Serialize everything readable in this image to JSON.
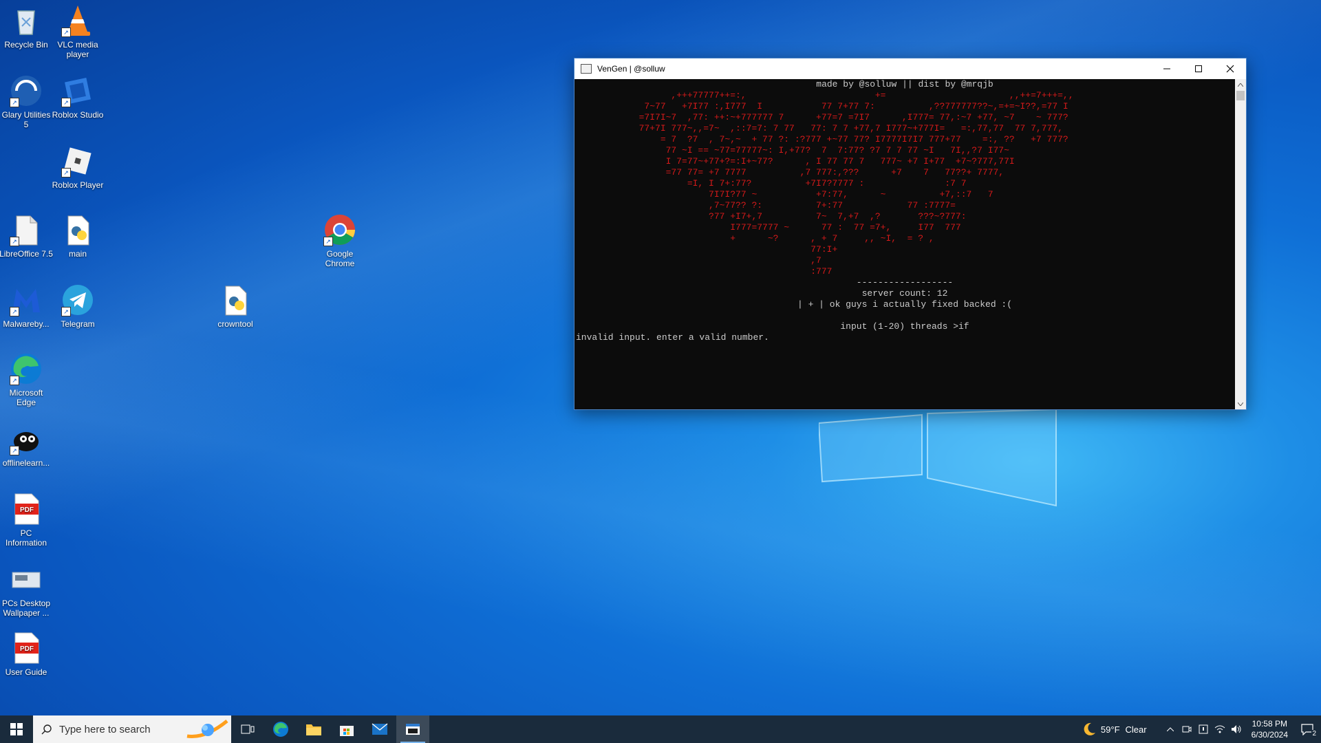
{
  "desktop": {
    "icons": [
      {
        "label": "Recycle Bin",
        "icon": "recycle-bin-icon"
      },
      {
        "label": "VLC media player",
        "icon": "vlc-icon"
      },
      {
        "label": "Glary Utilities 5",
        "icon": "glary-utilities-icon"
      },
      {
        "label": "Roblox Studio",
        "icon": "roblox-studio-icon"
      },
      {
        "label": "Roblox Player",
        "icon": "roblox-player-icon"
      },
      {
        "label": "LibreOffice 7.5",
        "icon": "libreoffice-icon"
      },
      {
        "label": "main",
        "icon": "python-file-icon"
      },
      {
        "label": "Google Chrome",
        "icon": "chrome-icon"
      },
      {
        "label": "Malwareby...",
        "icon": "malwarebytes-icon"
      },
      {
        "label": "Telegram",
        "icon": "telegram-icon"
      },
      {
        "label": "crowntool",
        "icon": "python-file-icon"
      },
      {
        "label": "Microsoft Edge",
        "icon": "edge-icon"
      },
      {
        "label": "offlinelearn...",
        "icon": "offlinelearn-icon"
      },
      {
        "label": "PC Information",
        "icon": "pdf-icon"
      },
      {
        "label": "PCs Desktop Wallpaper ...",
        "icon": "wallpaper-icon"
      },
      {
        "label": "User Guide",
        "icon": "pdf-icon"
      }
    ]
  },
  "window": {
    "title": "VenGen | @solluw",
    "console": {
      "header": "made by @solluw || dist by @mrqjb",
      "art": [
        "                  ,+++77777++=:,                        +=                       ,,++=7+++=,,",
        "             7~77   +7I77 :,I777  I           77 7+77 7:          ,??777777??~,=+=~I??,=77 I",
        "            =7I7I~7  ,77: ++:~+777777 7      +77=7 =7I7      ,I777= 77,:~7 +77, ~7    ~ 777?",
        "            77+7I 777~,,=7~  ,::7=7: 7 77   77: 7 7 +77,7 I777~+777I=   =:,77,77  77 7,777,",
        "                = 7  ?7  , 7~,~  + 77 ?: :?777 +~77 77? I7777I7I7 777+77    =:, ??   +7 777?",
        "                 77 ~I == ~77=77777~: I,+77?  7  7:77? ?7 7 7 77 ~I   7I,,?7 I77~",
        "                 I 7=77~+77+?=:I+~77?      , I 77 77 7   777~ +7 I+77  +7~?777,77I",
        "                 =77 77= +7 7777          ,7 777:,???      +7    7   77??+ 7777,",
        "                     =I, I 7+:77?          +7I7?7777 :               :7 7",
        "                         7I7I?77 ~           +7:77,      ~          +7,::7   7",
        "                         ,7~77?? ?:          7+:77            77 :7777=",
        "                         ?77 +I7+,7          7~  7,+7  ,?       ???~?777:",
        "                             I777=7777 ~      77 :  77 =7+,     I77  777",
        "                             +      ~?      , + 7     ,, ~I,  = ? ,",
        "                                            77:I+",
        "                                            ,7",
        "                                            :777"
      ],
      "divider": "------------------",
      "server_count": "server count: 12",
      "message": "| + | ok guys i actually fixed backed :(",
      "prompt": "input (1-20) threads >if",
      "error": "invalid input. enter a valid number."
    }
  },
  "taskbar": {
    "search_placeholder": "Type here to search",
    "apps": [
      "task-view-icon",
      "edge-icon",
      "file-explorer-icon",
      "store-icon",
      "mail-icon",
      "terminal-icon"
    ],
    "weather": {
      "temp": "59°F",
      "condition": "Clear"
    },
    "time": "10:58 PM",
    "date": "6/30/2024",
    "notification_count": "2"
  },
  "colors": {
    "console_red": "#d61a1a",
    "console_text": "#cccccc",
    "taskbar_bg": "#1a2b3c"
  }
}
